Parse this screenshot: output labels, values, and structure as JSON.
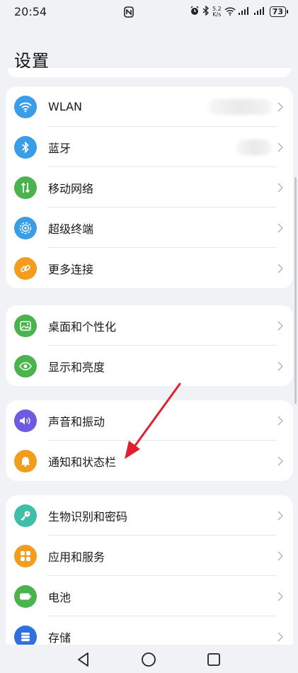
{
  "status": {
    "time": "20:54",
    "speed_value": "5.2",
    "speed_unit": "K/s",
    "battery": "73"
  },
  "page": {
    "title": "设置"
  },
  "groups": [
    {
      "items": [
        {
          "label": "WLAN",
          "icon": "wifi-icon",
          "color": "#3a9de8"
        },
        {
          "label": "蓝牙",
          "icon": "bluetooth-icon",
          "color": "#3a9de8"
        },
        {
          "label": "移动网络",
          "icon": "mobile-network-icon",
          "color": "#4bb34e"
        },
        {
          "label": "超级终端",
          "icon": "super-device-icon",
          "color": "#3a9de8"
        },
        {
          "label": "更多连接",
          "icon": "link-icon",
          "color": "#f39d1f"
        }
      ]
    },
    {
      "items": [
        {
          "label": "桌面和个性化",
          "icon": "wallpaper-icon",
          "color": "#4bb34e"
        },
        {
          "label": "显示和亮度",
          "icon": "eye-icon",
          "color": "#4bb34e"
        }
      ]
    },
    {
      "items": [
        {
          "label": "声音和振动",
          "icon": "speaker-icon",
          "color": "#6b5be0"
        },
        {
          "label": "通知和状态栏",
          "icon": "bell-icon",
          "color": "#f39d1f"
        }
      ]
    },
    {
      "items": [
        {
          "label": "生物识别和密码",
          "icon": "key-icon",
          "color": "#3fbfa8"
        },
        {
          "label": "应用和服务",
          "icon": "apps-icon",
          "color": "#f39d1f"
        },
        {
          "label": "电池",
          "icon": "battery-icon",
          "color": "#4bb34e"
        },
        {
          "label": "存储",
          "icon": "storage-icon",
          "color": "#2f6fe0"
        }
      ]
    }
  ]
}
